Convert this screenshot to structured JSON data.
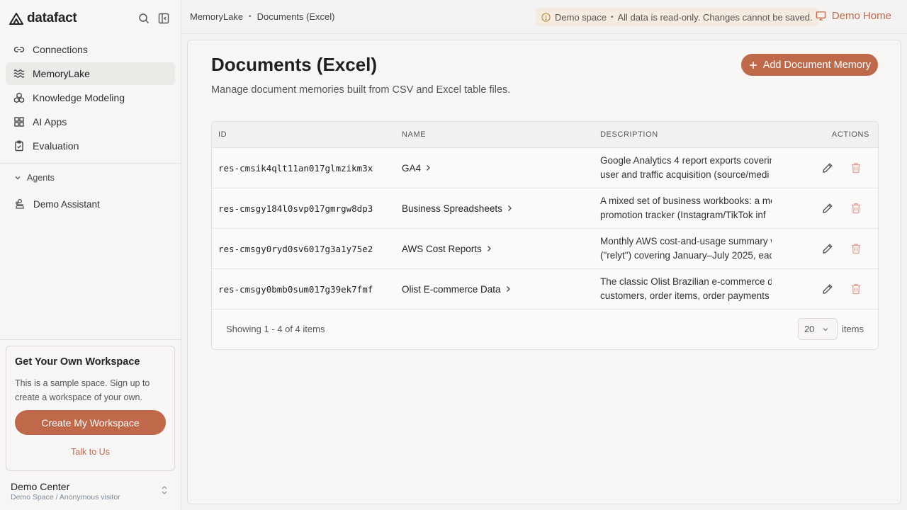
{
  "app": {
    "logo_text": "datafact"
  },
  "sidebar": {
    "items": [
      {
        "label": "Connections",
        "icon": "link-icon"
      },
      {
        "label": "MemoryLake",
        "icon": "waves-icon"
      },
      {
        "label": "Knowledge Modeling",
        "icon": "cubes-icon"
      },
      {
        "label": "AI Apps",
        "icon": "grid-icon"
      },
      {
        "label": "Evaluation",
        "icon": "clipboard-icon"
      }
    ],
    "active_item": "MemoryLake",
    "agents_header": "Agents",
    "agents": [
      {
        "label": "Demo Assistant",
        "icon": "bot-icon"
      }
    ],
    "workspace_card": {
      "title": "Get Your Own Workspace",
      "text": "This is a sample space. Sign up to create a workspace of your own.",
      "button": "Create My Workspace",
      "link": "Talk to Us"
    },
    "footer": {
      "title": "Demo Center",
      "subtitle": "Demo Space / Anonymous visitor"
    }
  },
  "topbar": {
    "breadcrumb": [
      "MemoryLake",
      "Documents (Excel)"
    ],
    "banner_label": "Demo space",
    "banner_text": "All data is read-only. Changes cannot be saved.",
    "demo_home": "Demo Home"
  },
  "page": {
    "title": "Documents (Excel)",
    "subtitle": "Manage document memories built from CSV and Excel table files.",
    "add_button": "Add Document Memory"
  },
  "table": {
    "headers": {
      "id": "ID",
      "name": "NAME",
      "description": "DESCRIPTION",
      "actions": "ACTIONS"
    },
    "rows": [
      {
        "id": "res-cmsik4qlt11an017glmzikm3x",
        "name": "GA4",
        "desc1": "Google Analytics 4 report exports coverin",
        "desc2": "user and traffic acquisition (source/medi"
      },
      {
        "id": "res-cmsgy184l0svp017gmrgw8dp3",
        "name": "Business Spreadsheets",
        "desc1": "A mixed set of business workbooks: a me",
        "desc2": "promotion tracker (Instagram/TikTok inf"
      },
      {
        "id": "res-cmsgy0ryd0sv6017g3a1y75e2",
        "name": "AWS Cost Reports",
        "desc1": "Monthly AWS cost-and-usage summary w",
        "desc2": "(\"relyt\") covering January–July 2025, eac"
      },
      {
        "id": "res-cmsgy0bmb0sum017g39ek7fmf",
        "name": "Olist E-commerce Data",
        "desc1": "The classic Olist Brazilian e-commerce d",
        "desc2": "customers, order items, order payments"
      }
    ],
    "footer_text": "Showing 1 - 4 of 4 items",
    "page_size": "20",
    "page_size_suffix": "items"
  },
  "colors": {
    "accent": "#c0694a",
    "banner_bg": "#f6ebe1"
  }
}
